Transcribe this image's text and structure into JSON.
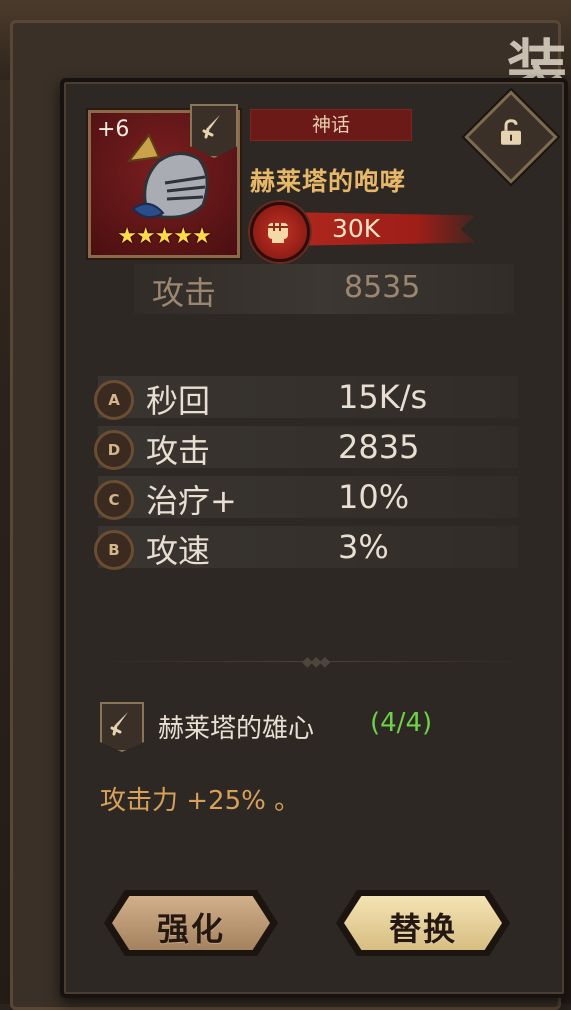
{
  "item": {
    "level": "+6",
    "stars": "★★★★★",
    "rarity": "神话",
    "name": "赫莱塔的咆哮",
    "power": "30K"
  },
  "main_stat": {
    "label": "攻击",
    "value": "8535"
  },
  "substats": [
    {
      "grade": "A",
      "label": "秒回",
      "value": "15K/s"
    },
    {
      "grade": "D",
      "label": "攻击",
      "value": "2835"
    },
    {
      "grade": "C",
      "label": "治疗+",
      "value": "10%"
    },
    {
      "grade": "B",
      "label": "攻速",
      "value": "3%"
    }
  ],
  "set": {
    "name": "赫莱塔的雄心",
    "count": "(4/4)",
    "effect": "攻击力 +25% 。"
  },
  "buttons": {
    "enhance": "强化",
    "replace": "替换"
  },
  "background": {
    "title_glyph": "装"
  },
  "colors": {
    "rarity_bg": "#6b1a17",
    "name": "#e8b86a",
    "set_count": "#6fd14a",
    "set_effect": "#d8a05a"
  },
  "icons": {
    "type": "sword-icon",
    "lock": "unlock-icon",
    "power": "fist-icon"
  }
}
